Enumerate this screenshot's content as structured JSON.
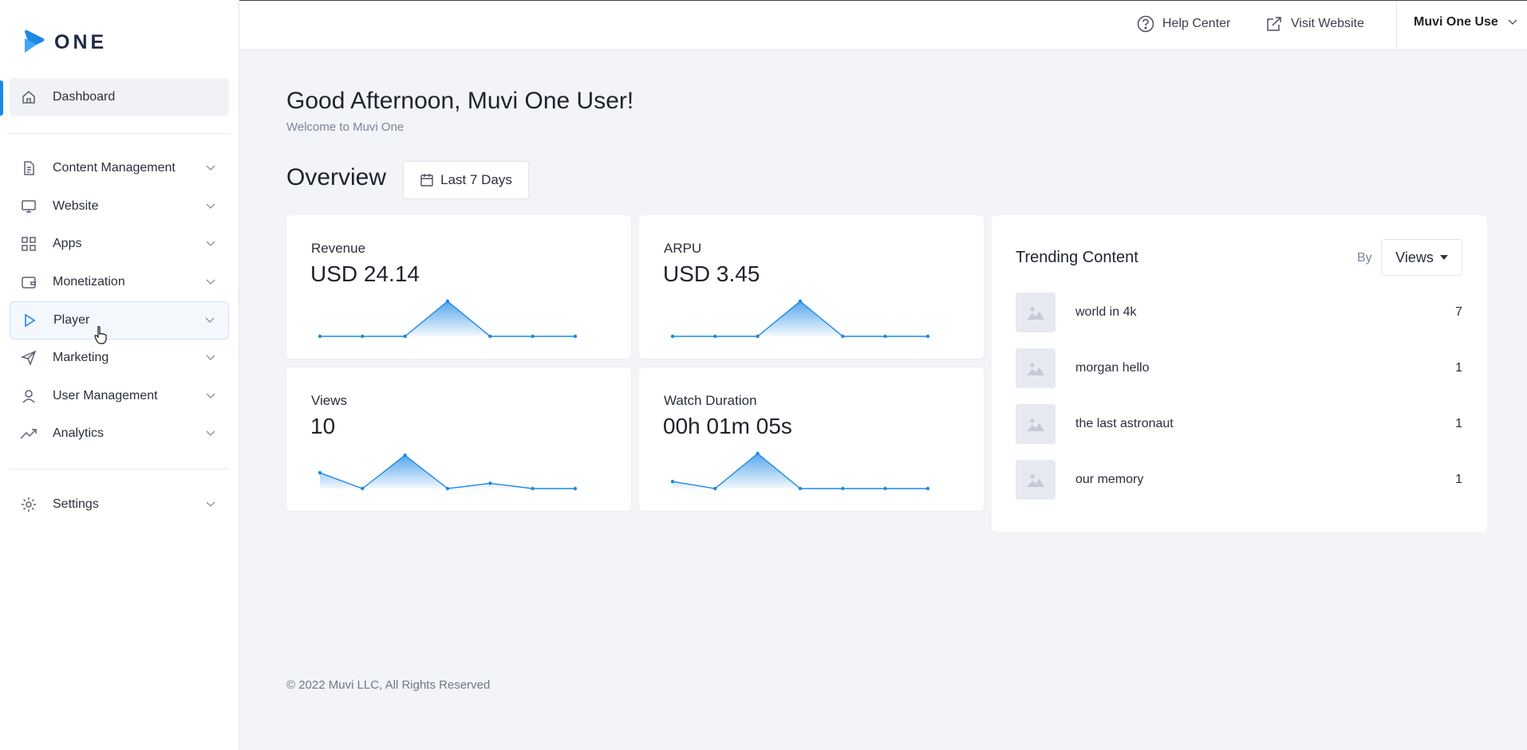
{
  "brand": {
    "logo_text": "ONE",
    "accent": "#1e88e5"
  },
  "sidebar": {
    "items": [
      {
        "key": "dashboard",
        "label": "Dashboard",
        "icon": "home-icon",
        "active": true
      },
      {
        "key": "content",
        "label": "Content Management",
        "icon": "document-icon"
      },
      {
        "key": "website",
        "label": "Website",
        "icon": "monitor-icon"
      },
      {
        "key": "apps",
        "label": "Apps",
        "icon": "grid-icon"
      },
      {
        "key": "monetization",
        "label": "Monetization",
        "icon": "wallet-icon"
      },
      {
        "key": "player",
        "label": "Player",
        "icon": "play-icon"
      },
      {
        "key": "marketing",
        "label": "Marketing",
        "icon": "send-icon"
      },
      {
        "key": "users",
        "label": "User Management",
        "icon": "user-icon"
      },
      {
        "key": "analytics",
        "label": "Analytics",
        "icon": "trend-icon"
      },
      {
        "key": "settings",
        "label": "Settings",
        "icon": "gear-icon"
      }
    ]
  },
  "topbar": {
    "help": "Help Center",
    "visit": "Visit Website",
    "user": "Muvi One Use"
  },
  "main": {
    "greeting": "Good Afternoon, Muvi One User!",
    "welcome": "Welcome to Muvi One",
    "overview": "Overview",
    "range": "Last 7 Days"
  },
  "cards": [
    {
      "title": "Revenue",
      "value": "USD 24.14",
      "series": [
        0,
        0,
        0,
        1,
        0,
        0,
        0
      ]
    },
    {
      "title": "ARPU",
      "value": "USD 3.45",
      "series": [
        0,
        0,
        0,
        1,
        0,
        0,
        0
      ]
    },
    {
      "title": "Views",
      "value": "10",
      "series": [
        0.45,
        0,
        0.95,
        0,
        0.15,
        0,
        0
      ]
    },
    {
      "title": "Watch Duration",
      "value": "00h 01m 05s",
      "series": [
        0.2,
        0,
        1,
        0,
        0,
        0,
        0
      ]
    }
  ],
  "trending": {
    "title": "Trending Content",
    "by_label": "By",
    "by_value": "Views",
    "items": [
      {
        "name": "world in 4k",
        "count": "7"
      },
      {
        "name": "morgan hello",
        "count": "1"
      },
      {
        "name": "the last astronaut",
        "count": "1"
      },
      {
        "name": "our memory",
        "count": "1"
      }
    ]
  },
  "footer": "© 2022 Muvi LLC, All Rights Reserved"
}
